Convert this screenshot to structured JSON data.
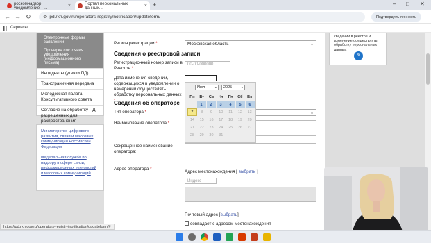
{
  "browser": {
    "tabs": [
      {
        "title": "роскомнадзор уведомление - ...",
        "close": "×"
      },
      {
        "title": "Портал персональных данных...",
        "close": "×"
      }
    ],
    "new_tab": "+",
    "window_controls": {
      "minimize": "–",
      "maximize": "□",
      "close": "✕"
    },
    "url": "pd.rkn.gov.ru/operators-registry/notification/updateform/",
    "verify_button": "Подтвердить личность",
    "bookmarks_label": "Сервисы"
  },
  "left_menu": {
    "gray_items": [
      "Электронные формы заявлений",
      "Проверка состояния уведомления (информационного письма)"
    ],
    "items": [
      "Инциденты (утечки ПД)",
      "Трансграничная передача",
      "Молодежная палата Консультативного совета",
      "Согласие на обработку ПД, разрешенных для распространения"
    ],
    "external_links": [
      "Министерство цифрового развития, связи и массовых коммуникаций Российской Федерации",
      "Федеральная служба по надзору в сфере связи, информационных технологий и массовых коммуникаций"
    ]
  },
  "form": {
    "region_label": "Регион  регистрации",
    "region_value": "Московская область",
    "registry_heading": "Сведения о реестровой записи",
    "reg_number_label": "Регистрационный номер записи в Реестре",
    "reg_number_placeholder": "00-00-000000",
    "change_date_label": "Дата изменения сведений, содержащихся в уведомлении о намерении осуществлять обработку персональных данных",
    "operator_heading": "Сведения об операторе",
    "operator_type_label": "Тип оператора",
    "operator_name_label": "Наименование оператора",
    "short_name_label": "Сокращенное наименование оператора:",
    "operator_address_label": "Адрес оператора",
    "location_address_label": "Адрес местонахождения",
    "choose_link": "выбрать",
    "zip_placeholder": "Индекс",
    "postal_address_label": "Почтовый адрес",
    "same_address_label": "совпадает с адресом местонахождения",
    "required_mark": "*"
  },
  "datepicker": {
    "month": "Июл",
    "year": "2025",
    "weekdays": [
      "Пн",
      "Вт",
      "Ср",
      "Чт",
      "Пт",
      "Сб",
      "Вс"
    ],
    "weeks": [
      [
        "",
        "1",
        "2",
        "3",
        "4",
        "5",
        "6"
      ],
      [
        "7",
        "8",
        "9",
        "10",
        "11",
        "12",
        "13"
      ],
      [
        "14",
        "15",
        "16",
        "17",
        "18",
        "19",
        "20"
      ],
      [
        "21",
        "22",
        "23",
        "24",
        "25",
        "26",
        "27"
      ],
      [
        "28",
        "29",
        "30",
        "31",
        "",
        "",
        ""
      ]
    ],
    "selected_day": "7"
  },
  "right_panel": {
    "text": "сведений в реестре и изменение осуществлять обработку персональных данных"
  },
  "status_url": "https://pd.rkn.gov.ru/operators-registry/notification/updateform/#",
  "colors": {
    "link": "#3a54a8",
    "active_day": "#b9d0e6",
    "selected_day": "#f5e88a",
    "edit_button": "#1f74c9"
  }
}
